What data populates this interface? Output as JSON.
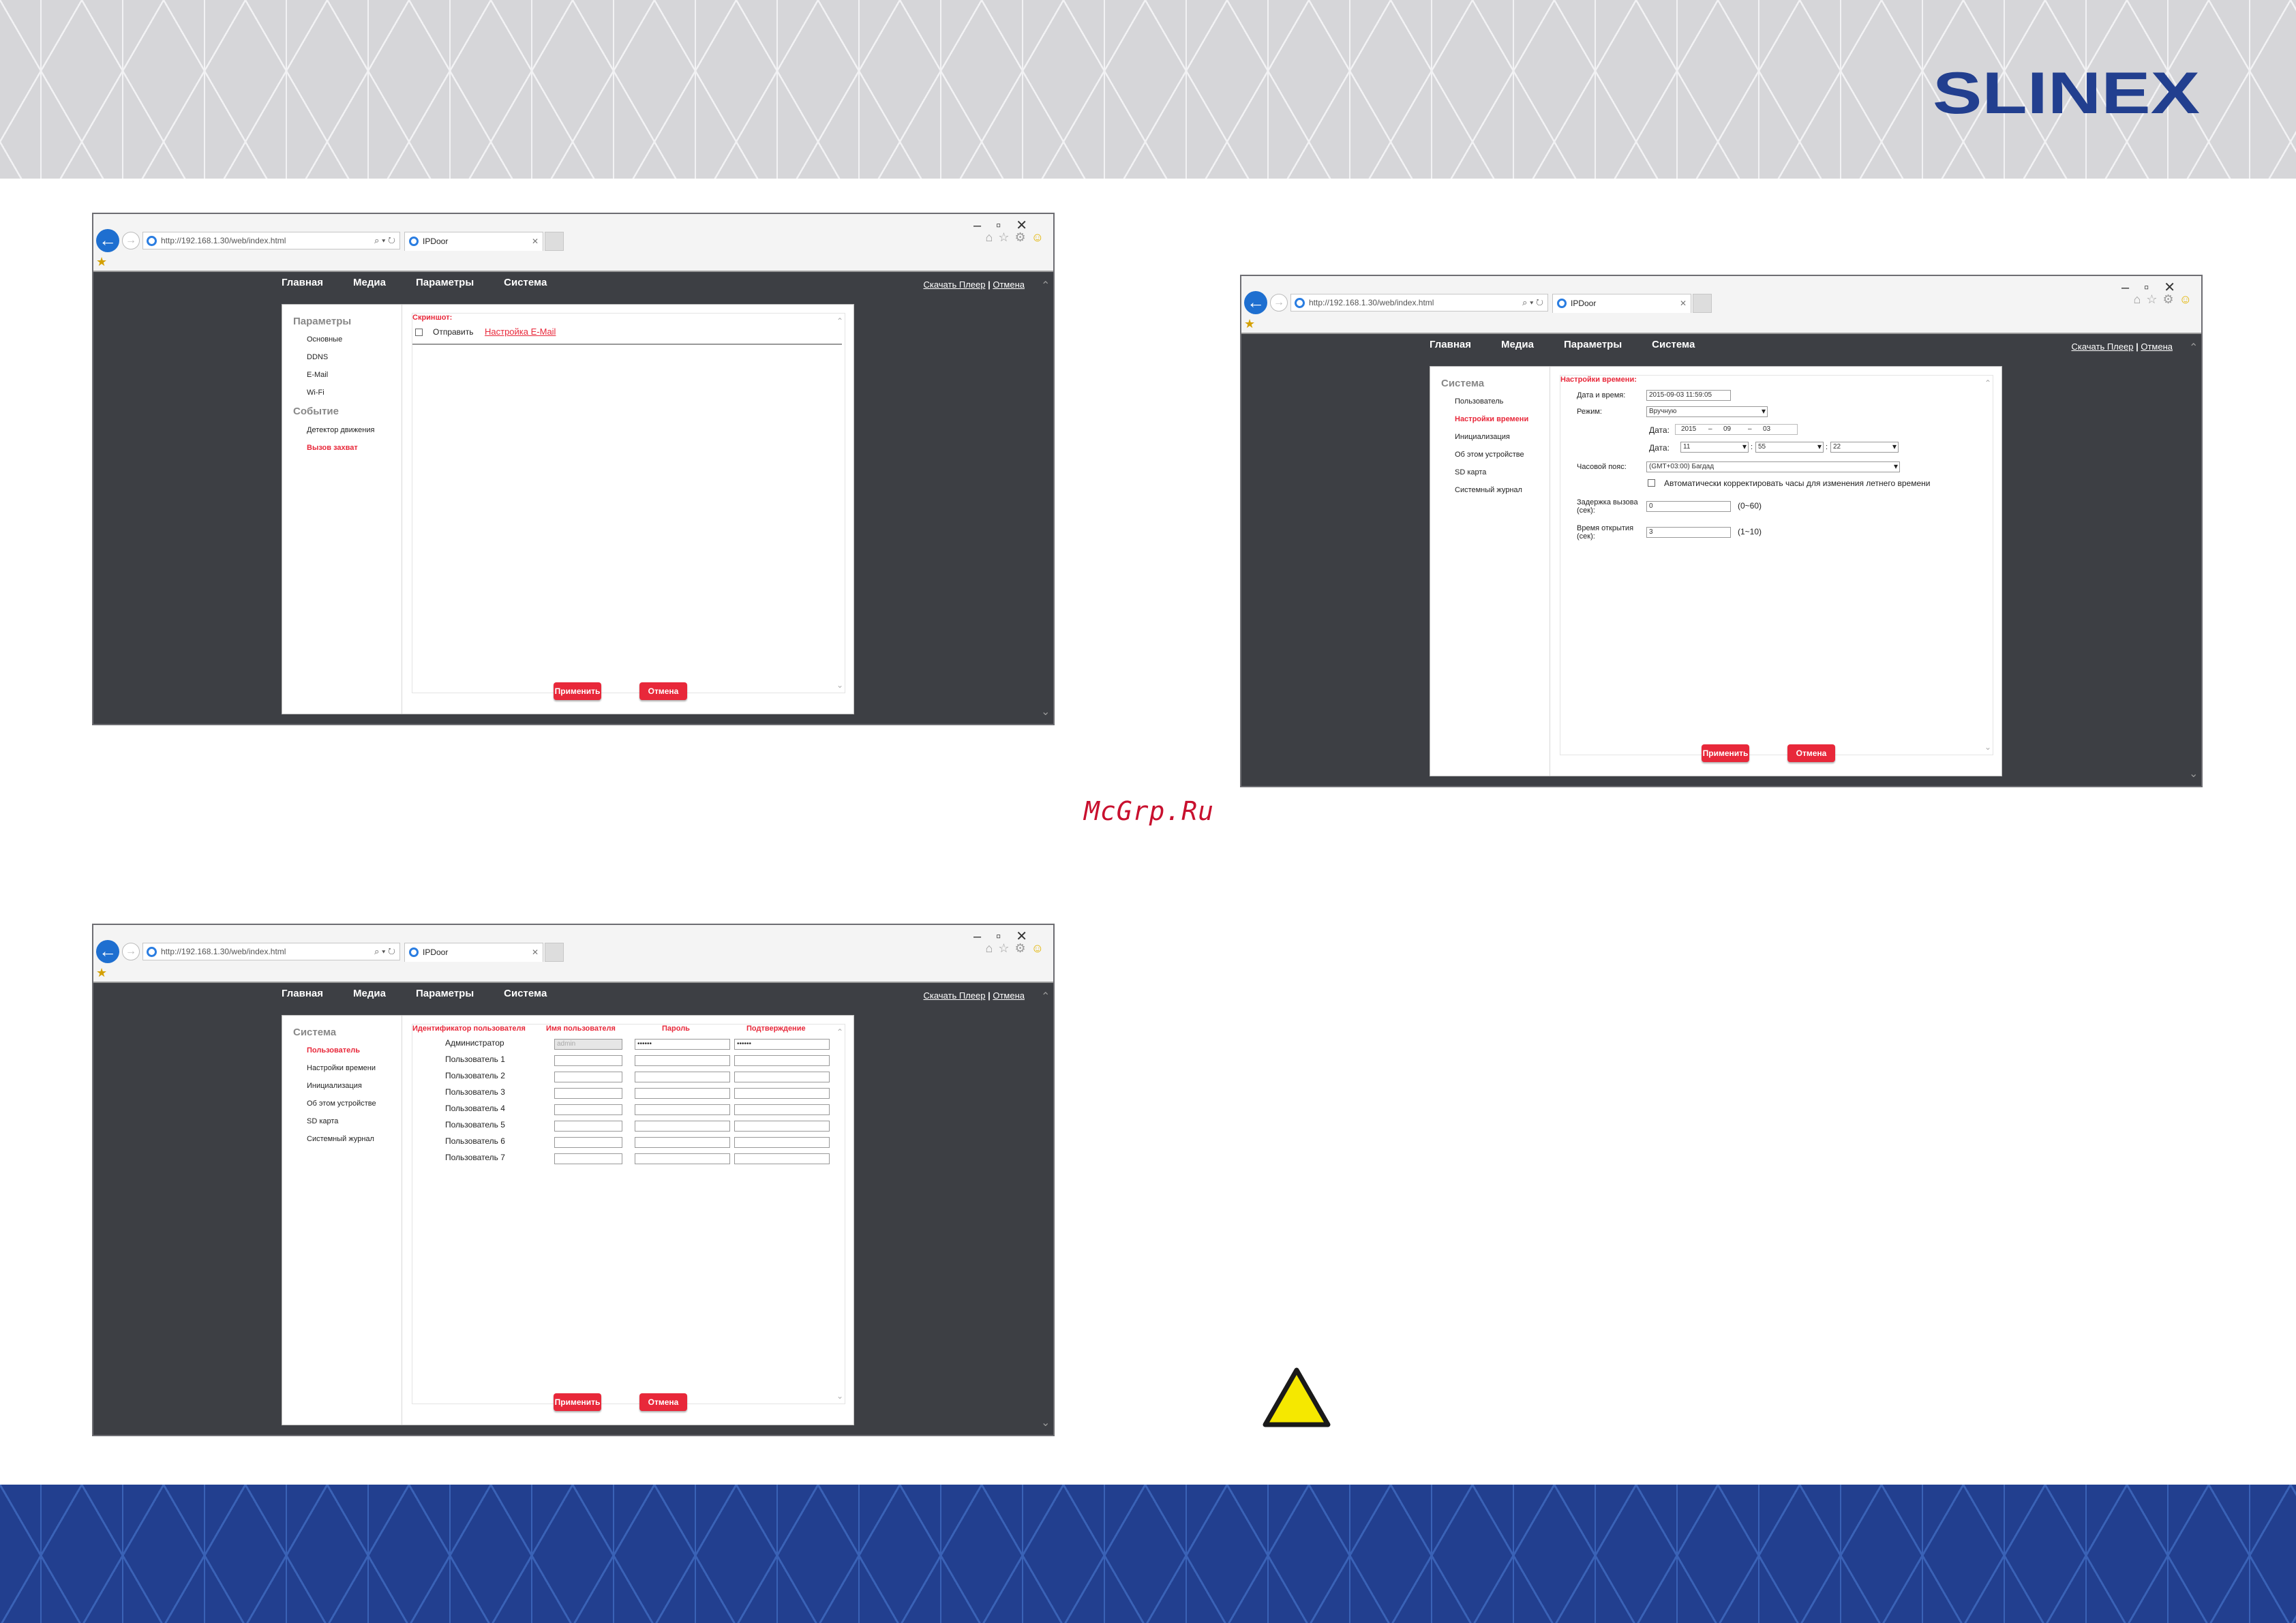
{
  "brand": {
    "logo_text": "SLINEX",
    "logo_color": "#223f8f"
  },
  "watermark": "McGrp.Ru",
  "accent_color": "#e8283a",
  "browser": {
    "url": "http://192.168.1.30/web/index.html",
    "tab_title": "IPDoor"
  },
  "nav": {
    "items": [
      "Главная",
      "Медиа",
      "Параметры",
      "Система"
    ]
  },
  "toplinks": {
    "download": "Скачать Плеер",
    "sep": "|",
    "cancel": "Отмена"
  },
  "buttons": {
    "apply": "Применить",
    "cancel": "Отмена"
  },
  "win1": {
    "sidebar": {
      "group1": "Параметры",
      "items1": [
        "Основные",
        "DDNS",
        "E-Mail",
        "Wi-Fi"
      ],
      "group2": "Событие",
      "items2": [
        "Детектор движения",
        "Вызов захват"
      ],
      "active": "Вызов захват"
    },
    "content": {
      "section_title": "Скриншот:",
      "send_label": "Отправить",
      "email_link": "Настройка E-Mail"
    }
  },
  "win2": {
    "sidebar": {
      "group": "Система",
      "items": [
        "Пользователь",
        "Настройки времени",
        "Инициализация",
        "Об этом устройстве",
        "SD карта",
        "Системный журнал"
      ],
      "active": "Настройки времени"
    },
    "content": {
      "section_title": "Настройки времени:",
      "datetime_label": "Дата и время:",
      "datetime_value": "2015-09-03 11:59:05",
      "mode_label": "Режим:",
      "mode_value": "Вручную",
      "date_label1": "Дата:",
      "date_y": "2015",
      "date_dash": "–",
      "date_m": "09",
      "date_d": "03",
      "date_label2": "Дата:",
      "time_h": "11",
      "time_m": "55",
      "time_s": "22",
      "time_sep": ":",
      "tz_label": "Часовой пояс:",
      "tz_value": "(GMT+03:00) Багдад",
      "dst_label": "Автоматически корректировать часы для изменения летнего времени",
      "call_delay_label1": "Задержка вызова",
      "call_delay_label2": "(сек):",
      "call_delay_value": "0",
      "call_delay_range": "(0~60)",
      "open_time_label1": "Время открытия",
      "open_time_label2": "(сек):",
      "open_time_value": "3",
      "open_time_range": "(1~10)"
    }
  },
  "win3": {
    "sidebar": {
      "group": "Система",
      "items": [
        "Пользователь",
        "Настройки времени",
        "Инициализация",
        "Об этом устройстве",
        "SD карта",
        "Системный журнал"
      ],
      "active": "Пользователь"
    },
    "table": {
      "headers": [
        "Идентификатор пользователя",
        "Имя пользователя",
        "Пароль",
        "Подтверждение"
      ],
      "rows": [
        {
          "id": "Администратор",
          "name": "admin",
          "password": "••••••",
          "confirm": "••••••"
        },
        {
          "id": "Пользователь 1",
          "name": "",
          "password": "",
          "confirm": ""
        },
        {
          "id": "Пользователь 2",
          "name": "",
          "password": "",
          "confirm": ""
        },
        {
          "id": "Пользователь 3",
          "name": "",
          "password": "",
          "confirm": ""
        },
        {
          "id": "Пользователь 4",
          "name": "",
          "password": "",
          "confirm": ""
        },
        {
          "id": "Пользователь 5",
          "name": "",
          "password": "",
          "confirm": ""
        },
        {
          "id": "Пользователь 6",
          "name": "",
          "password": "",
          "confirm": ""
        },
        {
          "id": "Пользователь 7",
          "name": "",
          "password": "",
          "confirm": ""
        }
      ]
    }
  }
}
